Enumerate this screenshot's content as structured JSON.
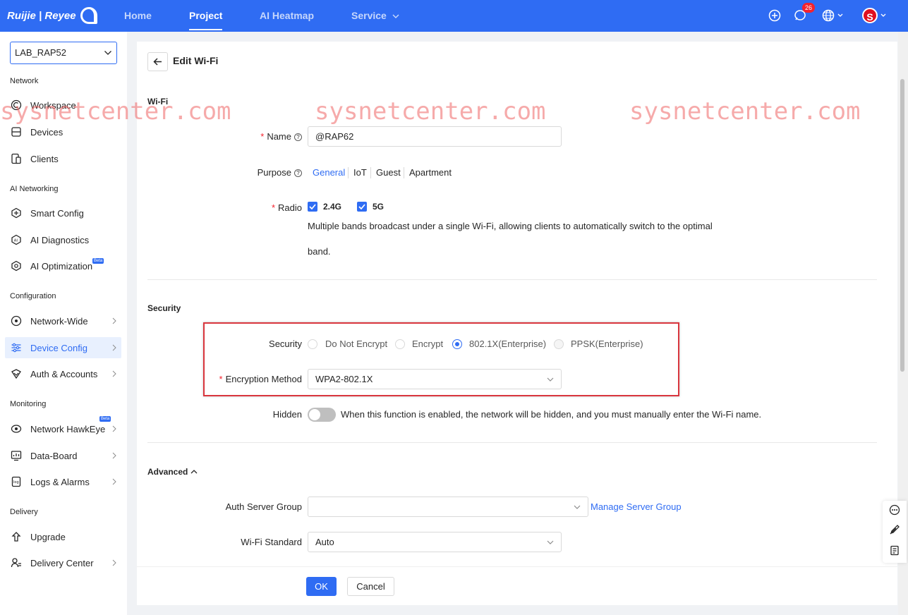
{
  "brand": {
    "name": "Ruijie | Reyee"
  },
  "nav": {
    "home": "Home",
    "project": "Project",
    "heatmap": "AI Heatmap",
    "service": "Service",
    "notifications": "26",
    "avatar": "S"
  },
  "sidebar": {
    "project": "LAB_RAP52",
    "sections": {
      "network": "Network",
      "ai": "AI Networking",
      "config": "Configuration",
      "monitoring": "Monitoring",
      "delivery": "Delivery"
    },
    "items": {
      "workspace": "Workspace",
      "devices": "Devices",
      "clients": "Clients",
      "smart_config": "Smart Config",
      "ai_diagnostics": "AI Diagnostics",
      "ai_optimization": "AI Optimization",
      "network_wide": "Network-Wide",
      "device_config": "Device Config",
      "auth_accounts": "Auth & Accounts",
      "hawkeye": "Network HawkEye",
      "data_board": "Data-Board",
      "logs_alarms": "Logs & Alarms",
      "upgrade": "Upgrade",
      "delivery_center": "Delivery Center"
    }
  },
  "page": {
    "title": "Edit Wi-Fi"
  },
  "wifi": {
    "section": "Wi-Fi",
    "name_label": "Name",
    "name_value": "@RAP62",
    "purpose_label": "Purpose",
    "purposes": [
      "General",
      "IoT",
      "Guest",
      "Apartment"
    ],
    "radio_label": "Radio",
    "band1": "2.4G",
    "band2": "5G",
    "radio_hint_1": "Multiple bands broadcast under a single Wi-Fi, allowing clients to automatically switch to the optimal",
    "radio_hint_2": "band."
  },
  "security": {
    "section": "Security",
    "label": "Security",
    "options": [
      "Do Not Encrypt",
      "Encrypt",
      "802.1X(Enterprise)",
      "PPSK(Enterprise)"
    ],
    "selected": "802.1X(Enterprise)",
    "enc_label": "Encryption Method",
    "enc_value": "WPA2-802.1X",
    "hidden_label": "Hidden",
    "hidden_hint": "When this function is enabled, the network will be hidden, and you must manually enter the Wi-Fi name."
  },
  "advanced": {
    "section": "Advanced",
    "auth_label": "Auth Server Group",
    "auth_value": "",
    "manage_link": "Manage Server Group",
    "standard_label": "Wi-Fi Standard",
    "standard_value": "Auto"
  },
  "footer": {
    "ok": "OK",
    "cancel": "Cancel"
  },
  "watermark": "sysnetcenter.com",
  "colors": {
    "primary": "#2f6cf3",
    "highlight": "#d9363e",
    "required": "#f5222d"
  }
}
